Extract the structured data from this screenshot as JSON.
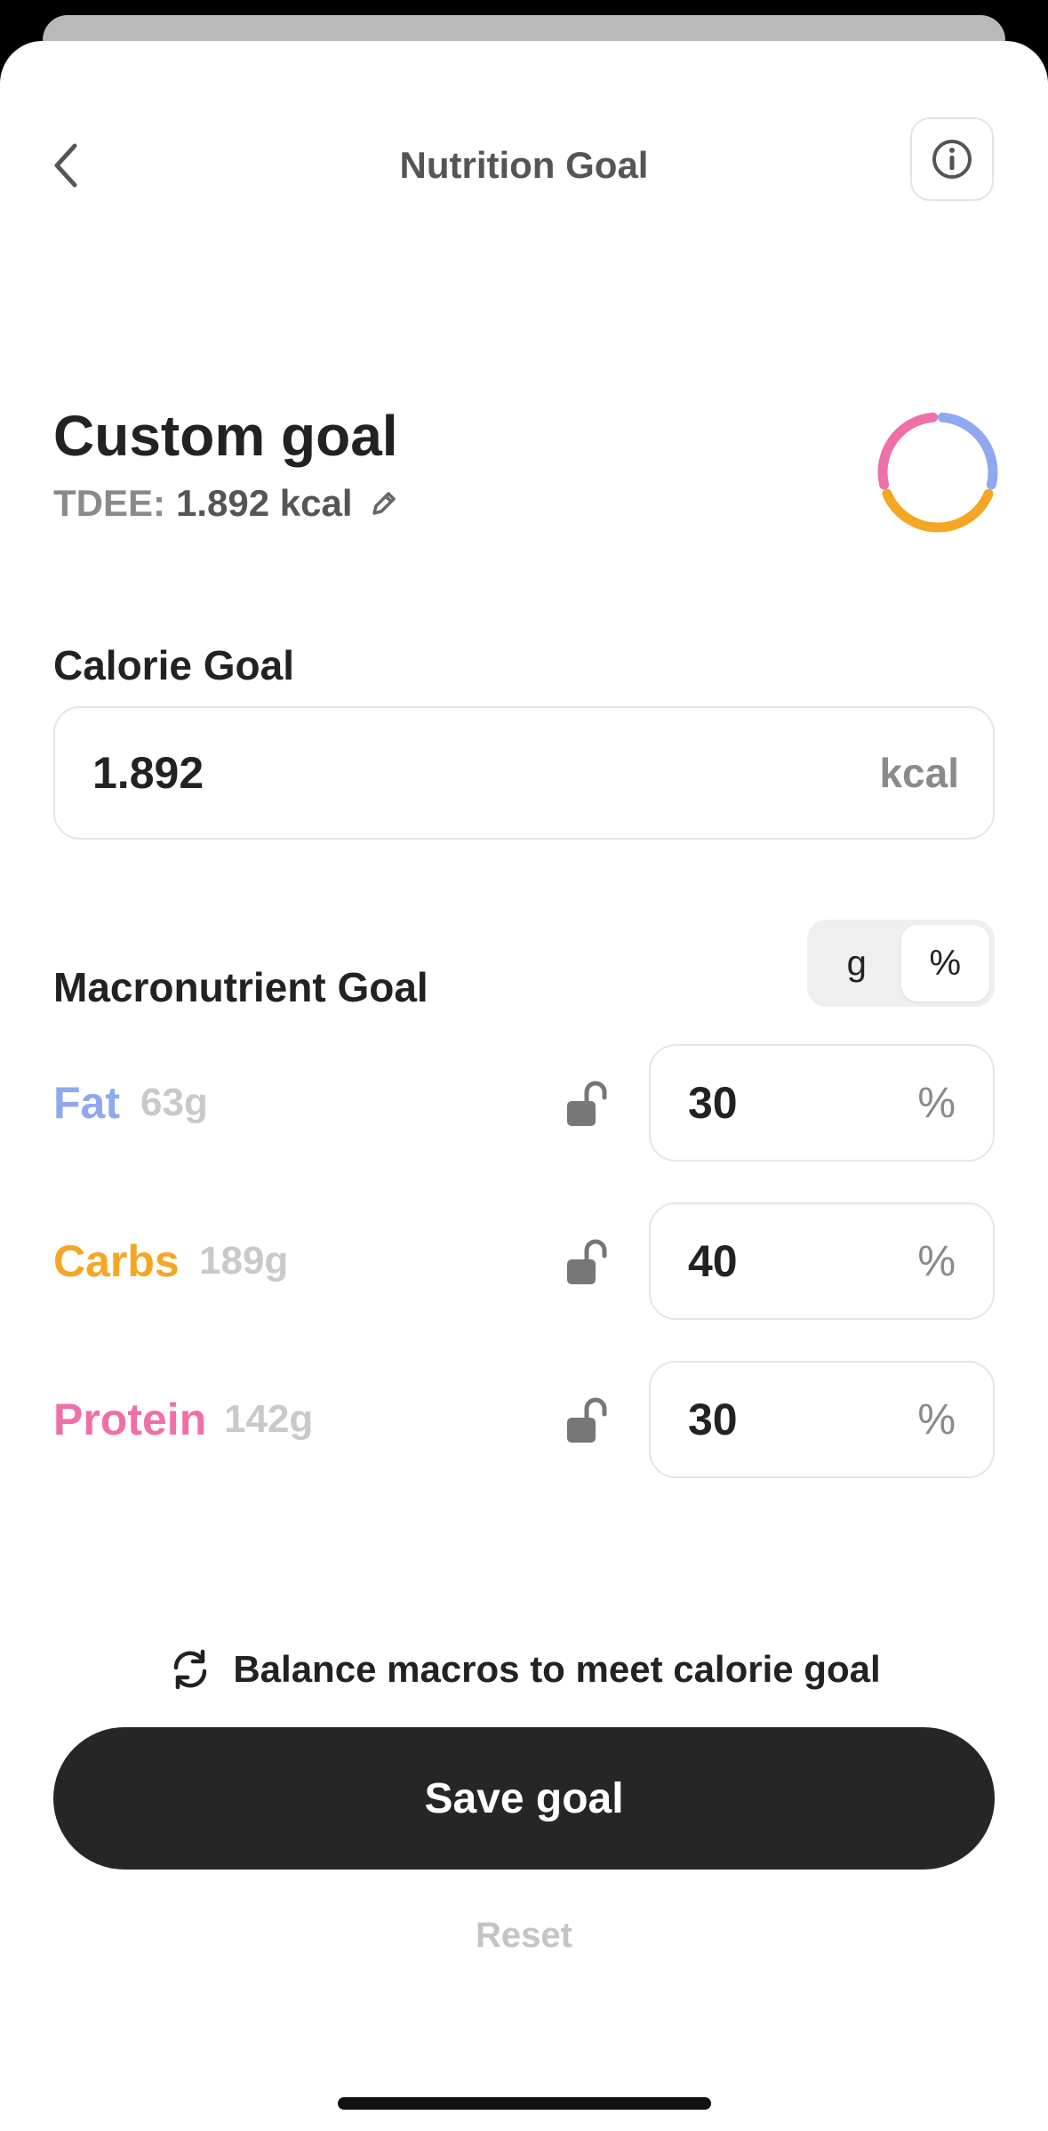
{
  "header": {
    "title": "Nutrition Goal"
  },
  "goal": {
    "title": "Custom goal",
    "tdee_label": "TDEE:",
    "tdee_value": "1.892 kcal"
  },
  "ring": {
    "fat_fraction": 0.3,
    "carbs_fraction": 0.4,
    "protein_fraction": 0.3
  },
  "calorie": {
    "label": "Calorie Goal",
    "value": "1.892",
    "unit": "kcal"
  },
  "macros": {
    "label": "Macronutrient Goal",
    "unit_toggle": {
      "options": [
        "g",
        "%"
      ],
      "selected": "%"
    },
    "items": [
      {
        "name": "Fat",
        "grams": "63g",
        "value": "30",
        "unit": "%",
        "color": "#8fa8f0"
      },
      {
        "name": "Carbs",
        "grams": "189g",
        "value": "40",
        "unit": "%",
        "color": "#f5a623"
      },
      {
        "name": "Protein",
        "grams": "142g",
        "value": "30",
        "unit": "%",
        "color": "#ef6fa8"
      }
    ]
  },
  "balance": {
    "label": "Balance macros to meet calorie goal"
  },
  "actions": {
    "save_label": "Save goal",
    "reset_label": "Reset"
  },
  "icons": {
    "back": "chevron-left-icon",
    "info": "info-icon",
    "edit": "pencil-icon",
    "lock": "unlocked-padlock-icon",
    "balance": "refresh-icon"
  }
}
